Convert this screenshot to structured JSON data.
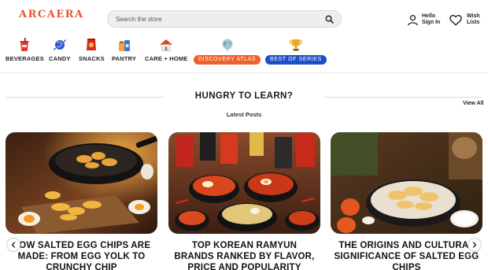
{
  "header": {
    "logo_text": "ARCAERA",
    "search": {
      "placeholder": "Search the store",
      "value": ""
    },
    "account": {
      "line1": "Hello",
      "line2": "Sign In"
    },
    "wishlist": {
      "line1": "Wish",
      "line2": "Lists"
    }
  },
  "nav": {
    "items": [
      {
        "label": "BEVERAGES",
        "icon": "soda-cup-icon"
      },
      {
        "label": "CANDY",
        "icon": "candy-icon"
      },
      {
        "label": "SNACKS",
        "icon": "snack-bag-icon"
      },
      {
        "label": "PANTRY",
        "icon": "pantry-jar-icon"
      },
      {
        "label": "CARE + HOME",
        "icon": "house-icon"
      },
      {
        "label": "DISCOVERY ATLAS",
        "icon": "globe-icon",
        "style": "pill",
        "color": "#f0602c"
      },
      {
        "label": "BEST OF SERIES",
        "icon": "trophy-icon",
        "style": "pill",
        "color": "#1d4fc7"
      }
    ]
  },
  "section": {
    "title": "HUNGRY TO LEARN?",
    "subtitle": "Latest Posts",
    "view_all": "View All"
  },
  "posts": [
    {
      "title": "HOW SALTED EGG CHIPS ARE MADE: FROM EGG YOLK TO CRUNCHY CHIP",
      "image": "salted-egg-chips-wok-photo"
    },
    {
      "title": "TOP KOREAN RAMYUN BRANDS RANKED BY FLAVOR, PRICE AND POPULARITY",
      "image": "korean-ramyun-bowls-photo"
    },
    {
      "title": "THE ORIGINS AND CULTURAL SIGNIFICANCE OF SALTED EGG CHIPS",
      "image": "salted-egg-chips-bowl-photo"
    }
  ],
  "carousel": {
    "prev_icon": "chevron-left-icon",
    "next_icon": "chevron-right-icon"
  },
  "colors": {
    "brand": "#e8542f",
    "pill_orange": "#f0602c",
    "pill_blue": "#1d4fc7"
  }
}
